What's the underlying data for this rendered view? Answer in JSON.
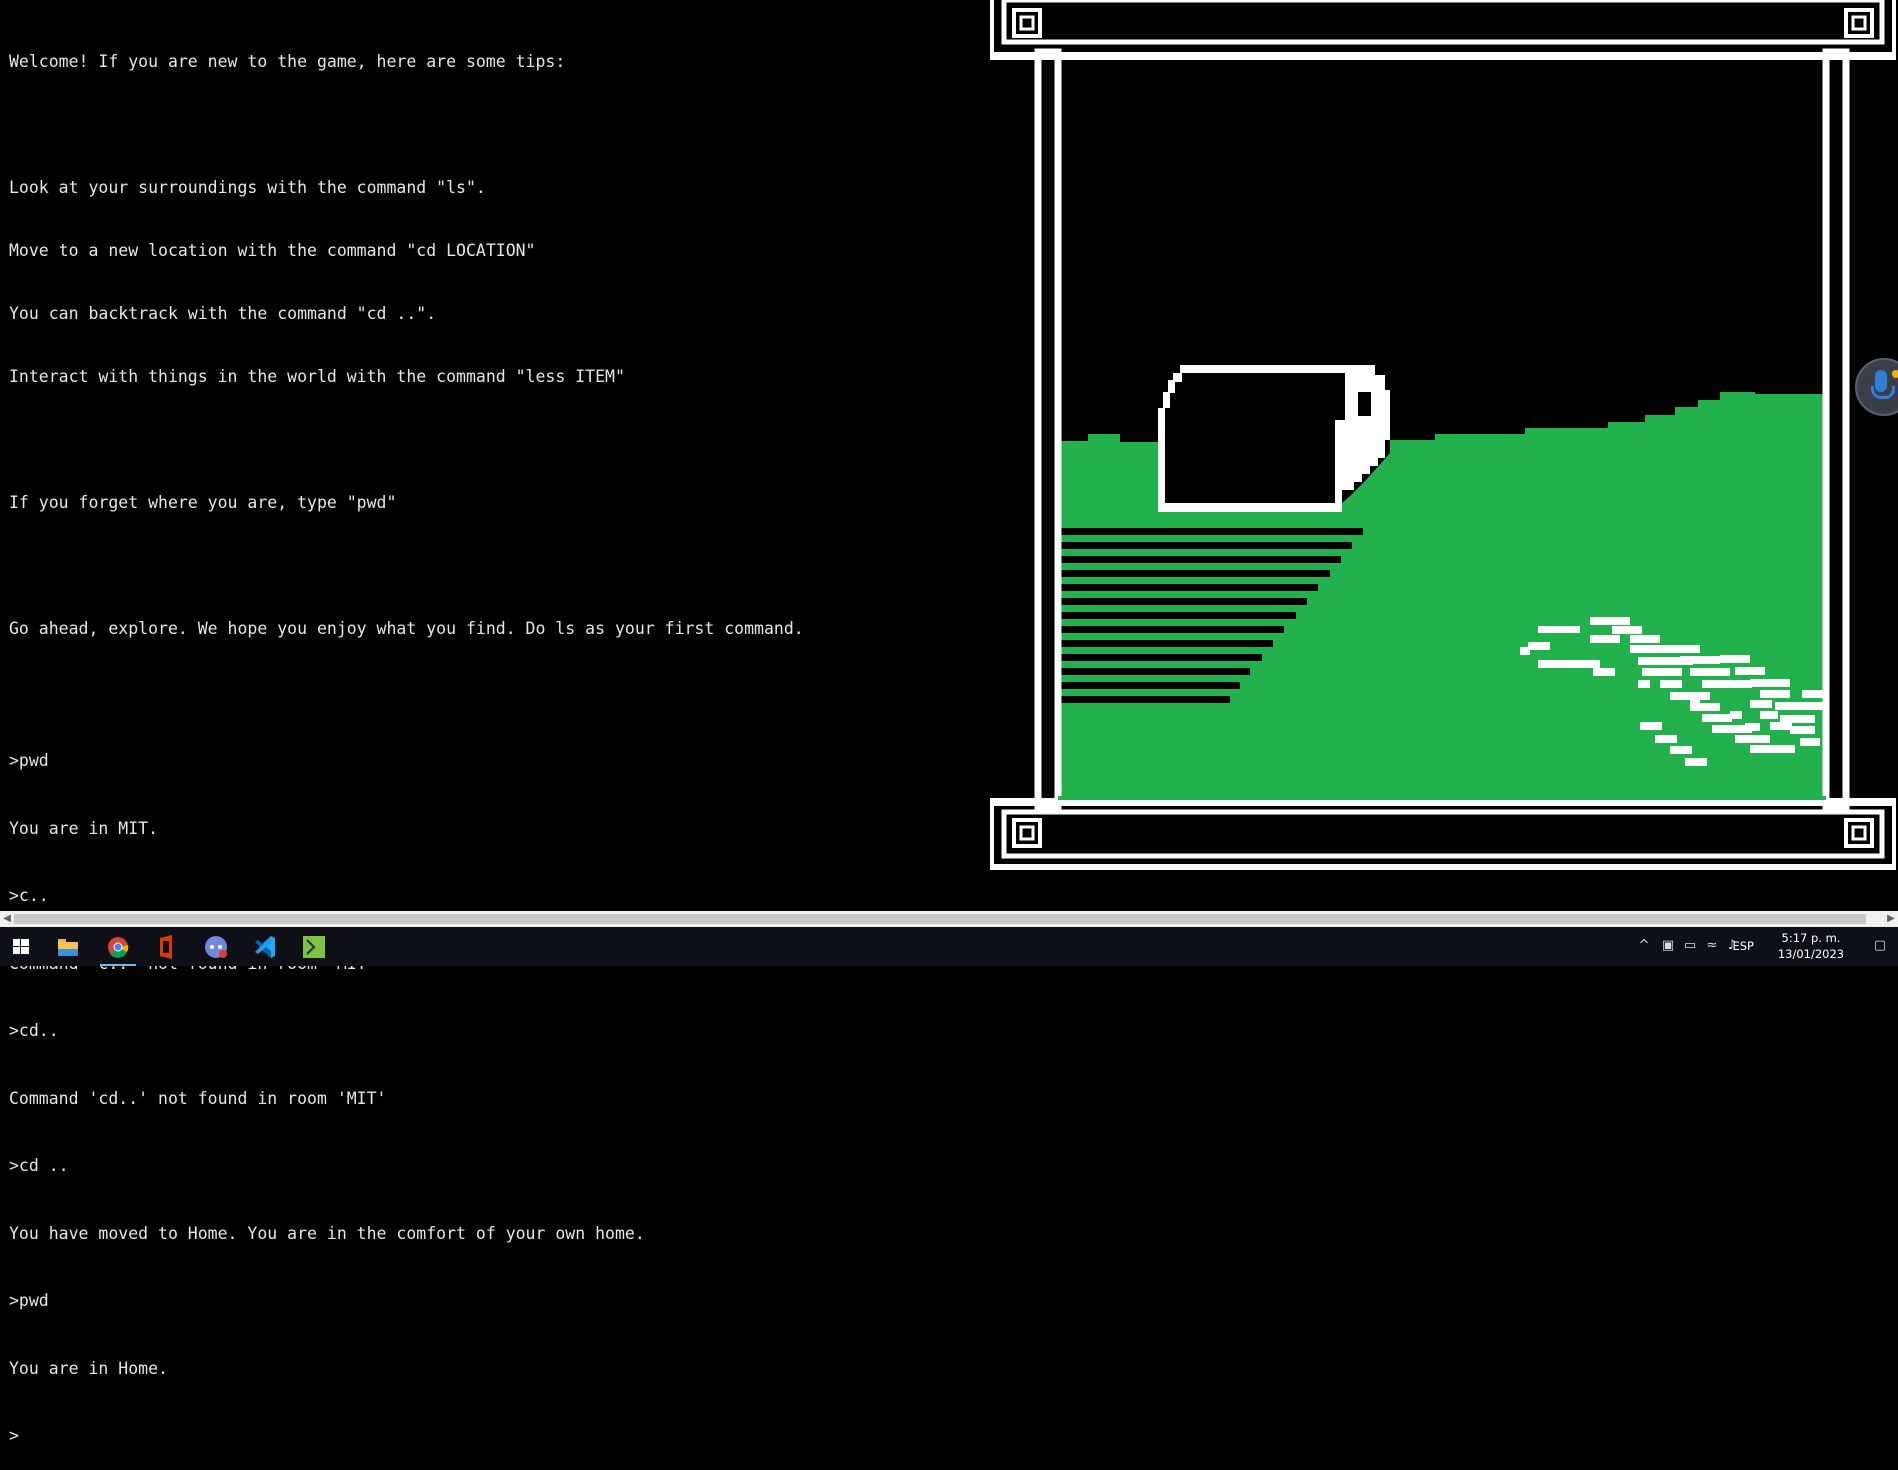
{
  "terminal": {
    "welcome": "Welcome! If you are new to the game, here are some tips:",
    "tips": [
      "Look at your surroundings with the command \"ls\".",
      "Move to a new location with the command \"cd LOCATION\"",
      "You can backtrack with the command \"cd ..\".",
      "Interact with things in the world with the command \"less ITEM\""
    ],
    "pwd_tip": "If you forget where you are, type \"pwd\"",
    "explore": "Go ahead, explore. We hope you enjoy what you find. Do ls as your first command.",
    "log": [
      ">pwd",
      "You are in MIT.",
      ">c..",
      "Command 'c..' not found in room 'MIT'",
      ">cd..",
      "Command 'cd..' not found in room 'MIT'",
      ">cd ..",
      "You have moved to Home. You are in the comfort of your own home.",
      ">pwd",
      "You are in Home."
    ],
    "prompt": ">"
  },
  "scene": {
    "grass_color": "#22b14c",
    "frame_color": "#ffffff"
  },
  "taskbar": {
    "apps": [
      "start-icon",
      "file-explorer-icon",
      "chrome-icon",
      "office-icon",
      "discord-icon",
      "vscode-icon",
      "terminal-game-icon"
    ],
    "language": "ESP",
    "time": "5:17 p. m.",
    "date": "13/01/2023"
  }
}
